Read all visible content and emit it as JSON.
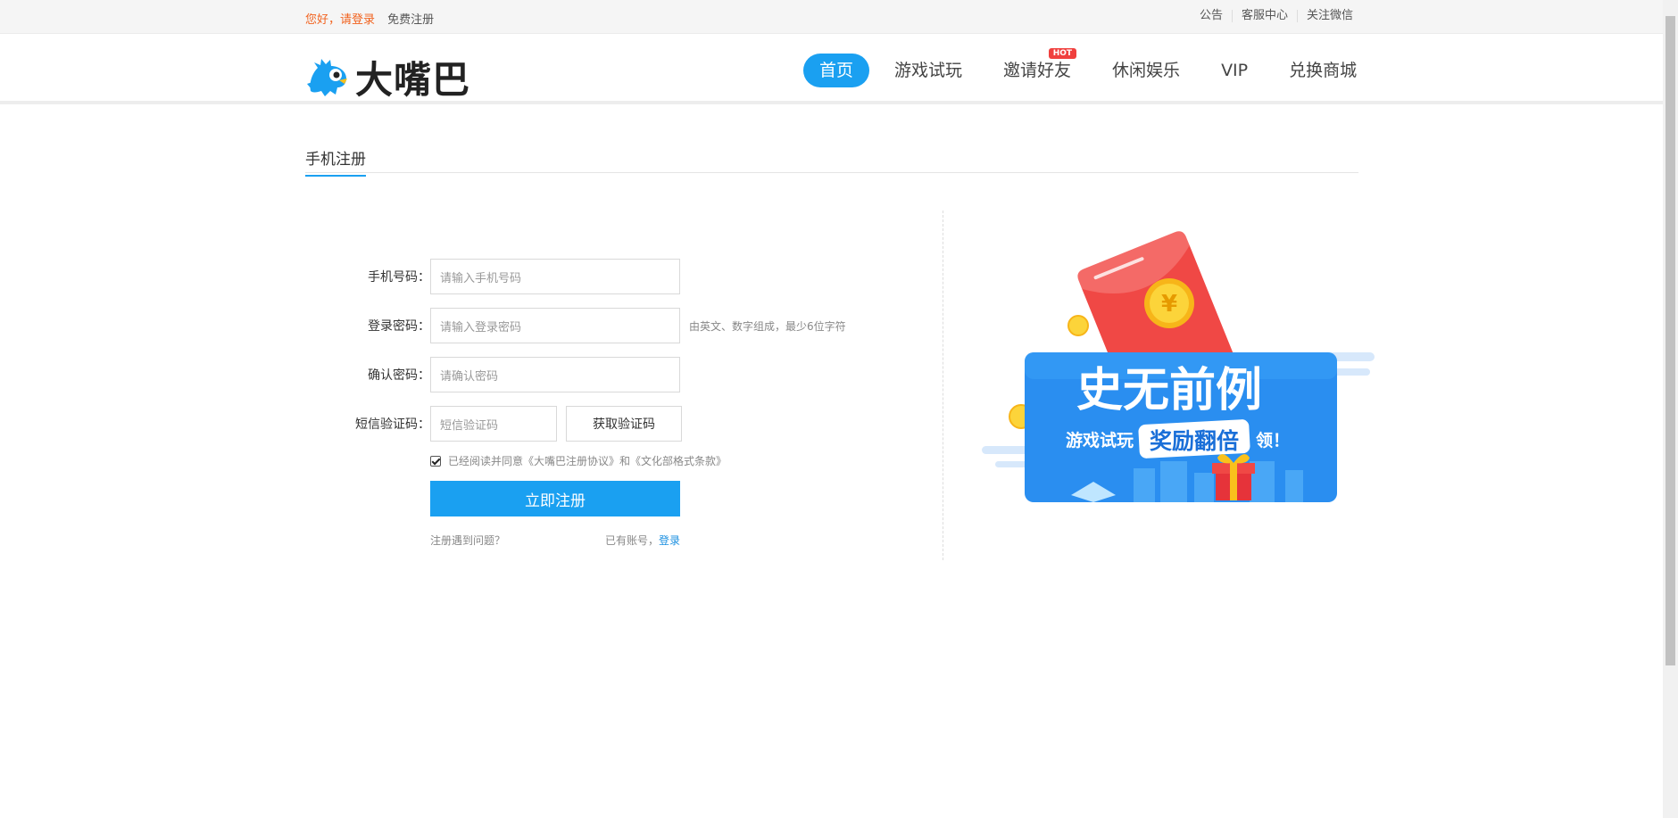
{
  "topbar": {
    "greeting": "您好，请登录",
    "register": "免费注册",
    "links": [
      "公告",
      "客服中心",
      "关注微信"
    ]
  },
  "header": {
    "logo_text": "大嘴巴",
    "nav": [
      {
        "label": "首页",
        "active": true
      },
      {
        "label": "游戏试玩"
      },
      {
        "label": "邀请好友",
        "badge": "HOT"
      },
      {
        "label": "休闲娱乐"
      },
      {
        "label": "VIP"
      },
      {
        "label": "兑换商城"
      }
    ]
  },
  "section_title": "手机注册",
  "form": {
    "phone_label": "手机号码：",
    "phone_placeholder": "请输入手机号码",
    "password_label": "登录密码：",
    "password_placeholder": "请输入登录密码",
    "password_hint": "由英文、数字组成，最少6位字符",
    "confirm_label": "确认密码：",
    "confirm_placeholder": "请确认密码",
    "sms_label": "短信验证码：",
    "sms_placeholder": "短信验证码",
    "sms_button": "获取验证码",
    "agreement": "已经阅读并同意《大嘴巴注册协议》和《文化部格式条款》",
    "agree_checked": true,
    "submit": "立即注册",
    "problem_link": "注册遇到问题？",
    "has_account": "已有账号，",
    "login_link": "登录"
  },
  "promo": {
    "headline": "史无前例",
    "sub_prefix": "游戏试玩",
    "sub_highlight": "奖励翻倍",
    "sub_suffix": "领！",
    "coin_symbol": "¥"
  },
  "colors": {
    "accent": "#1aa0f1",
    "greeting": "#f1621e",
    "hot_badge": "#f0403e",
    "envelope": "#f04845",
    "coin": "#f9c11c"
  }
}
